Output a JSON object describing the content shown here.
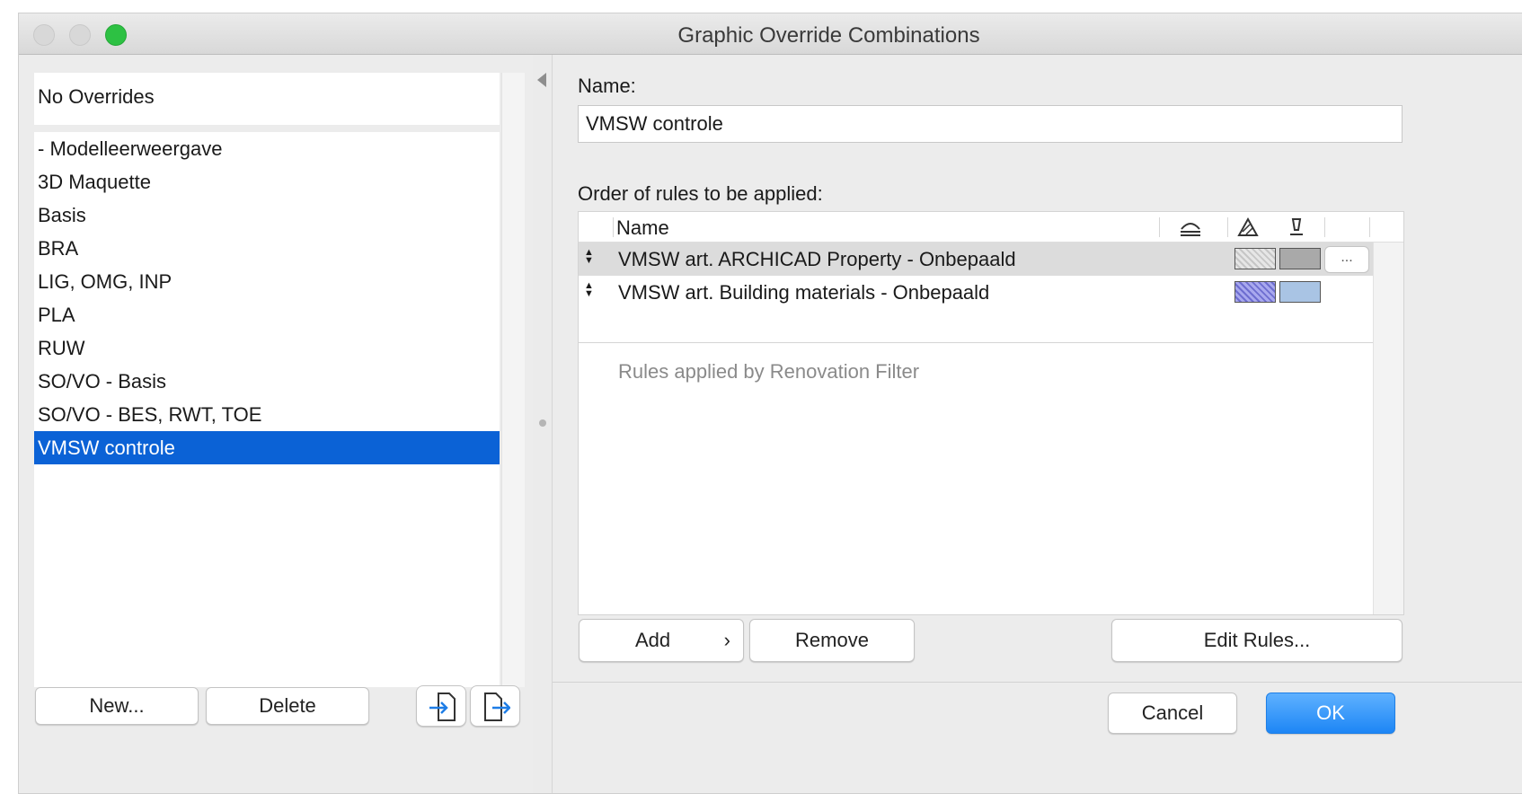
{
  "window": {
    "title": "Graphic Override Combinations"
  },
  "left": {
    "top_item": "No Overrides",
    "items": [
      "- Modelleerweergave",
      "3D Maquette",
      "Basis",
      "BRA",
      "LIG, OMG, INP",
      "PLA",
      "RUW",
      "SO/VO - Basis",
      "SO/VO - BES, RWT, TOE",
      "VMSW controle"
    ],
    "selected_index": 9,
    "new_label": "New...",
    "delete_label": "Delete",
    "import_icon": "import-icon",
    "export_icon": "export-icon"
  },
  "right": {
    "name_label": "Name:",
    "name_value": "VMSW controle",
    "order_label": "Order of rules to be applied:",
    "table": {
      "col_name": "Name",
      "rules": [
        {
          "name": "VMSW art. ARCHICAD Property - Onbepaald",
          "fill_color": "#d9d9d9",
          "line_color": "#a9a9a9",
          "more": "..."
        },
        {
          "name": "VMSW art. Building materials - Onbepaald",
          "fill_color": "#8f8fe0",
          "line_color": "#a9c4e4"
        }
      ],
      "renovation_text": "Rules applied by Renovation Filter"
    },
    "add_label": "Add",
    "add_chevron": "›",
    "remove_label": "Remove",
    "edit_label": "Edit Rules..."
  },
  "footer": {
    "cancel_label": "Cancel",
    "ok_label": "OK"
  },
  "colors": {
    "selection": "#0b62d6",
    "ok_button": "#1d86f5"
  }
}
